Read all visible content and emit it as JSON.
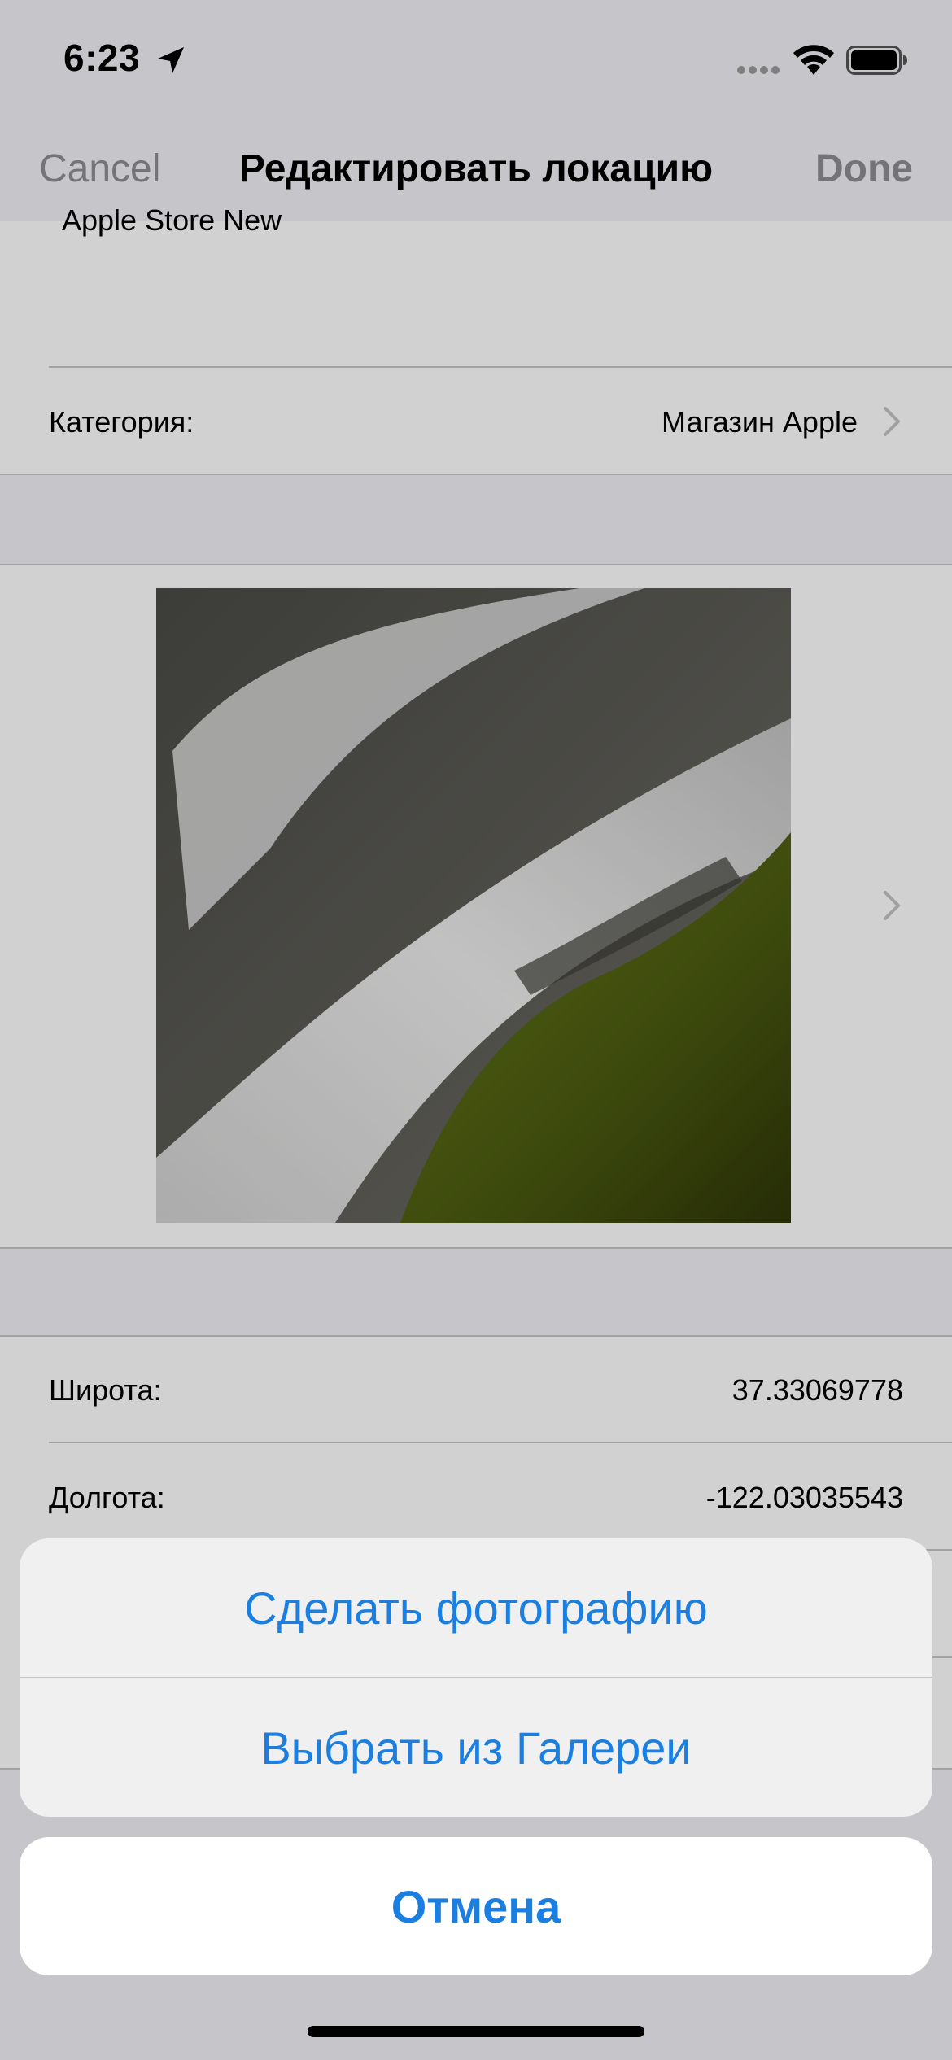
{
  "status_bar": {
    "time": "6:23"
  },
  "nav": {
    "cancel": "Cancel",
    "title": "Редактировать локацию",
    "done": "Done"
  },
  "form": {
    "name": "Apple Store New",
    "category_label": "Категория:",
    "category_value": "Магазин Apple",
    "latitude_label": "Широта:",
    "latitude_value": "37.33069778",
    "longitude_label": "Долгота:",
    "longitude_value": "-122.03035543"
  },
  "action_sheet": {
    "take_photo": "Сделать фотографию",
    "choose_gallery": "Выбрать из Галереи",
    "cancel": "Отмена"
  },
  "colors": {
    "accent": "#1a7fe0",
    "disabled": "#8e8e93",
    "background": "#f2f2f7"
  }
}
